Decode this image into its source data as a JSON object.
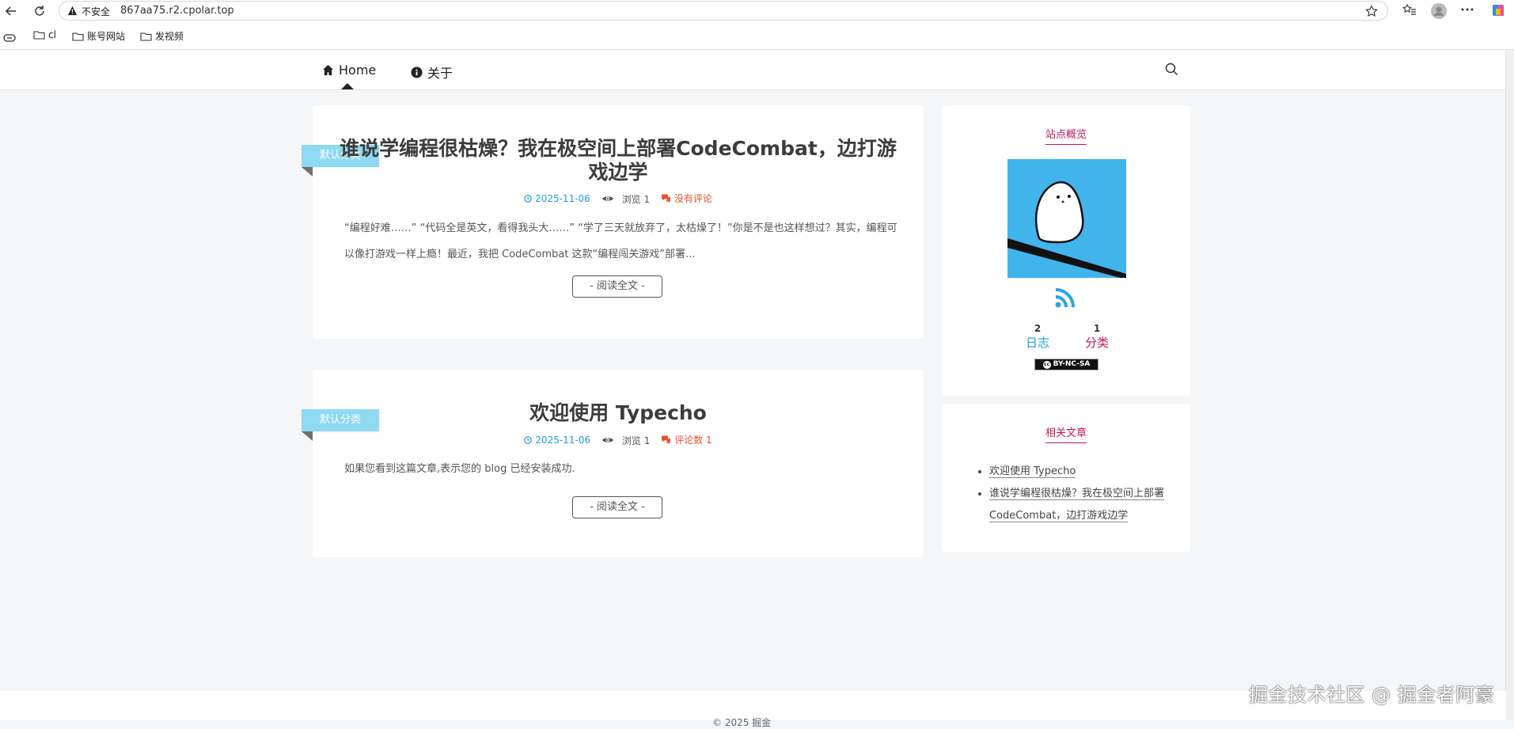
{
  "browser": {
    "insecure_label": "不安全",
    "url": "867aa75.r2.cpolar.top",
    "bookmarks": [
      "cl",
      "账号网站",
      "发视频"
    ]
  },
  "nav": {
    "home": "Home",
    "about": "关于"
  },
  "posts": [
    {
      "category": "默认分类",
      "title": "谁说学编程很枯燥？我在极空间上部署CodeCombat，边打游戏边学",
      "date": "2025-11-06",
      "views": "浏览 1",
      "comments": "没有评论",
      "excerpt": "“编程好难……” “代码全是英文，看得我头大……” “学了三天就放弃了，太枯燥了！”你是不是也这样想过？其实，编程可以像打游戏一样上瘾！最近，我把 CodeCombat 这款“编程闯关游戏”部署...",
      "read_more": "- 阅读全文 -"
    },
    {
      "category": "默认分类",
      "title": "欢迎使用 Typecho",
      "date": "2025-11-06",
      "views": "浏览 1",
      "comments": "评论数 1",
      "excerpt": "如果您看到这篇文章,表示您的 blog 已经安装成功.",
      "read_more": "- 阅读全文 -"
    }
  ],
  "sidebar": {
    "overview_title": "站点概览",
    "stats": [
      {
        "num": "2",
        "label": "日志",
        "color": "#1d9fd8"
      },
      {
        "num": "1",
        "label": "分类",
        "color": "#c2185b"
      }
    ],
    "license": "BY-NC-SA",
    "related_title": "相关文章",
    "related": [
      "欢迎使用 Typecho",
      "谁说学编程很枯燥？我在极空间上部署CodeCombat，边打游戏边学"
    ]
  },
  "footer": {
    "text": "© 2025 掘金"
  },
  "watermark": "掘金技术社区 @ 掘金者阿豪",
  "colors": {
    "accent_blue": "#1d9fd8",
    "accent_pink": "#c2185b",
    "ribbon": "#8fd9f3",
    "comment_red": "#e8502d"
  }
}
